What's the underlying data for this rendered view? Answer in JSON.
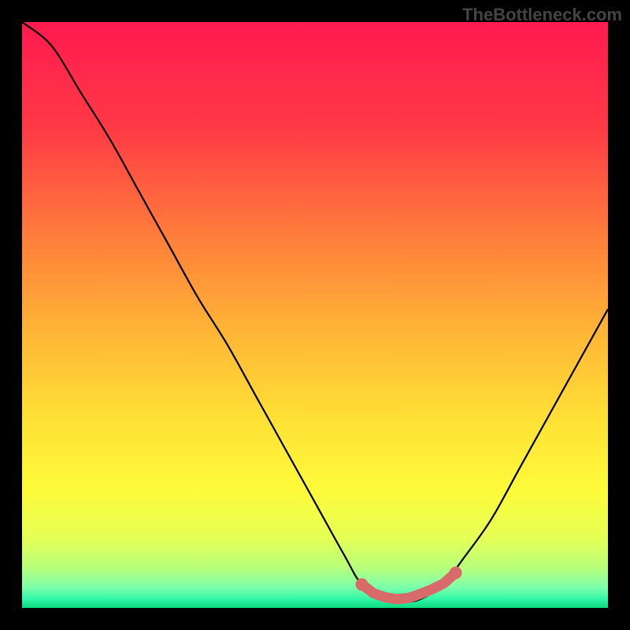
{
  "watermark": "TheBottleneck.com",
  "chart_data": {
    "type": "line",
    "title": "",
    "xlabel": "",
    "ylabel": "",
    "xlim": [
      0,
      100
    ],
    "ylim": [
      0,
      100
    ],
    "grid": false,
    "legend": false,
    "series": [
      {
        "name": "curve",
        "x": [
          0,
          5,
          10,
          15,
          20,
          25,
          30,
          35,
          40,
          45,
          50,
          55,
          58,
          62,
          65,
          68,
          72,
          75,
          80,
          85,
          90,
          95,
          100
        ],
        "y": [
          100,
          96,
          88,
          80,
          71,
          62,
          53,
          45,
          36,
          27,
          18,
          9,
          4,
          1.5,
          1,
          1.5,
          4,
          8,
          15,
          24,
          33,
          42,
          51
        ]
      }
    ],
    "annotations": [
      {
        "name": "marker-region",
        "type": "points",
        "color": "#d96a6a",
        "x": [
          58,
          60,
          62,
          64,
          66,
          68,
          70,
          72,
          74
        ],
        "y": [
          4,
          2.5,
          1.8,
          1.5,
          1.7,
          2.4,
          3.2,
          4.2,
          6
        ]
      }
    ],
    "background_gradient": {
      "stops": [
        {
          "offset": 0.0,
          "color": "#ff1a4f"
        },
        {
          "offset": 0.18,
          "color": "#ff3946"
        },
        {
          "offset": 0.36,
          "color": "#ff7b3b"
        },
        {
          "offset": 0.52,
          "color": "#ffb236"
        },
        {
          "offset": 0.68,
          "color": "#ffe136"
        },
        {
          "offset": 0.8,
          "color": "#fdfb3a"
        },
        {
          "offset": 0.88,
          "color": "#e6ff55"
        },
        {
          "offset": 0.93,
          "color": "#b9ff7a"
        },
        {
          "offset": 0.965,
          "color": "#7dffac"
        },
        {
          "offset": 0.985,
          "color": "#30f7a8"
        },
        {
          "offset": 1.0,
          "color": "#0cd87e"
        }
      ]
    }
  }
}
